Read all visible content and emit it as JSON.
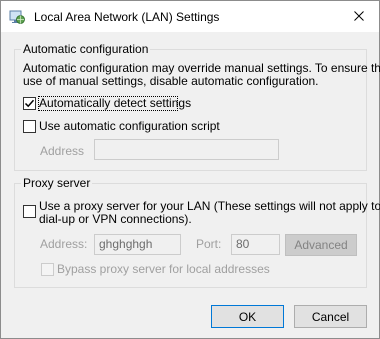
{
  "window": {
    "title": "Local Area Network (LAN) Settings"
  },
  "auto_config": {
    "legend": "Automatic configuration",
    "description_line1": "Automatic configuration may override manual settings.  To ensure the",
    "description_line2": "use of manual settings, disable automatic configuration.",
    "detect_label": "Automatically detect settings",
    "detect_checked": true,
    "script_label": "Use automatic configuration script",
    "script_checked": false,
    "address_label": "Address",
    "address_value": ""
  },
  "proxy": {
    "legend": "Proxy server",
    "use_proxy_line1": "Use a proxy server for your LAN (These settings will not apply to",
    "use_proxy_line2": "dial-up or VPN connections).",
    "use_proxy_checked": false,
    "address_label": "Address:",
    "address_value": "ghghghgh",
    "port_label": "Port:",
    "port_value": "80",
    "advanced_label": "Advanced",
    "bypass_label": "Bypass proxy server for local addresses",
    "bypass_checked": false
  },
  "footer": {
    "ok_label": "OK",
    "cancel_label": "Cancel"
  },
  "icons": {
    "window": "network-globe-icon",
    "close": "close-icon",
    "checkmark": "checkmark-icon"
  },
  "colors": {
    "dialog_bg": "#f0f0f0",
    "titlebar_bg": "#ffffff",
    "default_button_border": "#0078d7",
    "disabled_text": "#a0a0a0"
  }
}
